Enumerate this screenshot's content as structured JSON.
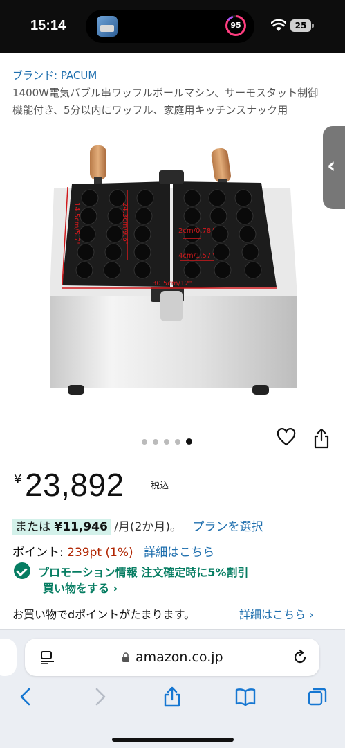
{
  "status_bar": {
    "time": "15:14",
    "activity_ring_value": "95",
    "battery": "25"
  },
  "product": {
    "brand_link": "ブランド: PACUM",
    "title": "1400W電気バブル串ワッフルボールマシン、サーモスタット制御機能付き、5分以内にワッフル、家庭用キッチンスナック用",
    "image_labels": {
      "dim_height": "14.5cm/5.7\"",
      "dim_depth": "24.3cm/9.6\"",
      "dim_hole": "2cm/0.78\"",
      "dim_ball": "4cm/1.57\"",
      "dim_width": "30.5cm/12\""
    },
    "image_dots": {
      "total": 5,
      "active_index": 4
    }
  },
  "price": {
    "currency": "¥",
    "amount": "23,892",
    "tax_label": "税込"
  },
  "installment": {
    "prefix": "または",
    "amount": "¥11,946",
    "term": "/月(2か月)。",
    "plan_link": "プランを選択"
  },
  "points": {
    "label": "ポイント:",
    "value": "239pt",
    "percent": "(1%)",
    "link": "詳細はこちら"
  },
  "promotion": {
    "text": "プロモーション情報 注文確定時に5%割引",
    "link": "買い物をする ›"
  },
  "dpoint": {
    "text": "お買い物でdポイントがたまります。",
    "link": "詳細はこちら ›"
  },
  "browser": {
    "url": "amazon.co.jp"
  },
  "colors": {
    "link": "#1f6fae",
    "promo_green": "#067d62",
    "points_red": "#b12704",
    "installment_bg": "#d3f1ea"
  }
}
